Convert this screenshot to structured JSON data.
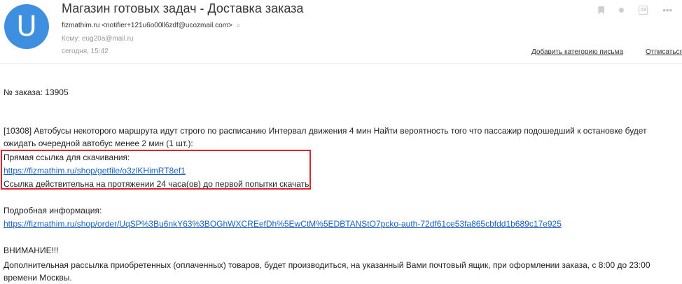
{
  "header": {
    "avatar_letter": "U",
    "subject": "Магазин готовых задач - Доставка заказа",
    "sender_name": "fizmathim.ru",
    "sender_email": "<notifier+121u6o00ll6zdf@ucozmail.com>",
    "to_label": "Кому:",
    "to_value": "eug20a@mail.ru",
    "date": "сегодня, 15:42",
    "add_category": "Добавить категорию письма",
    "unsubscribe": "Отписаться",
    "icons": [
      "bookmark-icon",
      "dot-icon",
      "calendar-icon",
      "more-icon"
    ],
    "calendar_day": "23"
  },
  "body": {
    "order_line": "№ заказа: 13905",
    "item_text": "[10308] Автобусы некоторого маршрута идут строго по расписанию Интервал движения 4 мин Найти вероятность того что пассажир подошедший к остановке будет ожидать очередной автобус менее 2 мин (1 шт.):",
    "direct_link_label": "Прямая ссылка для скачивания:",
    "direct_link_url": "https://fizmathim.ru/shop/getfile/o3zlKHimRT8ef1",
    "link_validity": "Ссылка действительна на протяжении 24 часа(ов) до первой попытки скачать",
    "more_info_label": "Подробная информация:",
    "more_info_url": "https://fizmathim.ru/shop/order/UqSP%3Bu6nkY63%3BOGhWXCREefDh%5EwCtM%5EDBTANStO7pcko-auth-72df61ce53fa865cbfdd1b689c17e925",
    "attention": "ВНИМАНИЕ!!!",
    "notice": "Дополнительная рассылка приобретенных (оплаченных) товаров, будет производиться, на указанный Вами почтовый ящик, при оформлении заказа, с 8:00 до 23:00 времени Москвы."
  },
  "colors": {
    "avatar": "#3f8fe0",
    "link": "#1a62c4",
    "highlight_border": "#e0242c"
  }
}
